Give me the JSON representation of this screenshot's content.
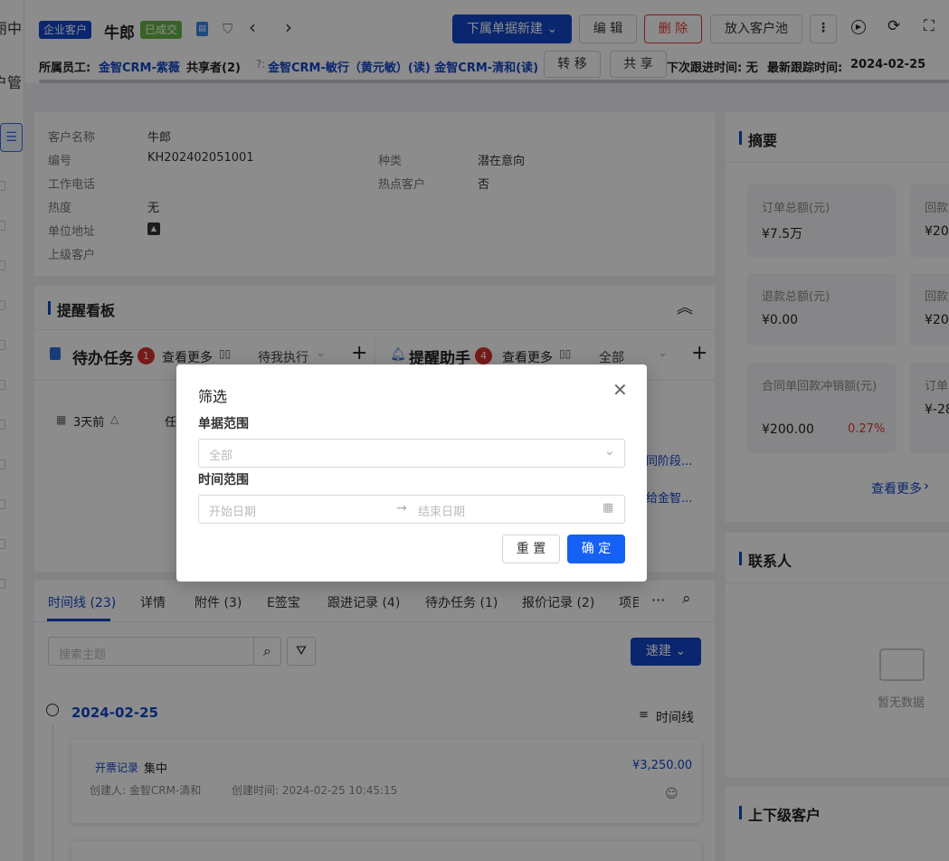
{
  "left_strip": {
    "text1": "丽中",
    "text2": "户管",
    "list_icon": "list-icon"
  },
  "header": {
    "customer_type": "企业客户",
    "customer_name": "牛郎",
    "status": "已成交",
    "primary_action": "下属单据新建",
    "edit": "编 辑",
    "delete": "删 除",
    "to_pool": "放入客户池",
    "owner_label": "所属员工:",
    "owner": "金智CRM-紫薇",
    "sharer_label": "共享者(2)",
    "sharers": "金智CRM-敏行（黄元敏）(读)  金智CRM-清和(读)",
    "transfer": "转 移",
    "share": "共 享",
    "next_follow": "下次跟进时间: 无",
    "last_follow_label": "最新跟踪时间:",
    "last_follow": "2024-02-25"
  },
  "info": {
    "fields": [
      {
        "label": "客户名称",
        "value": "牛郎"
      },
      {
        "label": "编号",
        "value": "KH202402051001"
      },
      {
        "label": "工作电话",
        "value": ""
      },
      {
        "label": "热度",
        "value": "无"
      },
      {
        "label": "单位地址",
        "value": ""
      },
      {
        "label": "上级客户",
        "value": ""
      }
    ],
    "right_fields": [
      {
        "label": "种类",
        "value": "潜在意向"
      },
      {
        "label": "热点客户",
        "value": "否"
      }
    ]
  },
  "reminder": {
    "title": "提醒看板",
    "todo_title": "待办任务",
    "todo_count": "1",
    "todo_more": "查看更多",
    "todo_filter": "待我执行",
    "assistant_title": "提醒助手",
    "assistant_count": "4",
    "assistant_more": "查看更多",
    "assistant_filter": "全部",
    "todo_item_time": "3天前",
    "todo_item_text": "任",
    "assistant_item1": "同阶段...",
    "assistant_item2": "给金智..."
  },
  "tabs": [
    {
      "label": "时间线 (23)",
      "active": true
    },
    {
      "label": "详情"
    },
    {
      "label": "附件 (3)"
    },
    {
      "label": "E签宝"
    },
    {
      "label": "跟进记录 (4)"
    },
    {
      "label": "待办任务 (1)"
    },
    {
      "label": "报价记录 (2)"
    },
    {
      "label": "项目"
    }
  ],
  "timeline": {
    "search_placeholder": "搜索主题",
    "quick_new": "速建",
    "date": "2024-02-25",
    "mode": "时间线",
    "entry": {
      "type": "开票记录",
      "title": "集中",
      "amount": "¥3,250.00",
      "creator": "创建人: 金智CRM-清和",
      "created": "创建时间: 2024-02-25 10:45:15"
    }
  },
  "summary": {
    "title": "摘要",
    "metrics": [
      {
        "label": "订单总额(元)",
        "value": "¥7.5万"
      },
      {
        "label": "回款",
        "value": "¥20"
      },
      {
        "label": "退款总额(元)",
        "value": "¥0.00"
      },
      {
        "label": "回款",
        "value": "¥20"
      },
      {
        "label": "合同单回款冲销额(元)",
        "value": "¥200.00",
        "extra": "0.27%"
      },
      {
        "label": "订单",
        "value": "¥-28"
      }
    ],
    "more": "查看更多"
  },
  "contacts": {
    "title": "联系人",
    "empty": "暂无数据"
  },
  "hierarchy": {
    "title": "上下级客户"
  },
  "dialog": {
    "title": "筛选",
    "range_label": "单据范围",
    "range_value": "全部",
    "time_label": "时间范围",
    "start_placeholder": "开始日期",
    "end_placeholder": "结束日期",
    "reset": "重 置",
    "confirm": "确 定"
  },
  "colors": {
    "accent": "#1246c8",
    "confirm": "#1560f5",
    "status_green": "#67b44a",
    "danger": "#e53935",
    "badge": "#d9302f"
  }
}
